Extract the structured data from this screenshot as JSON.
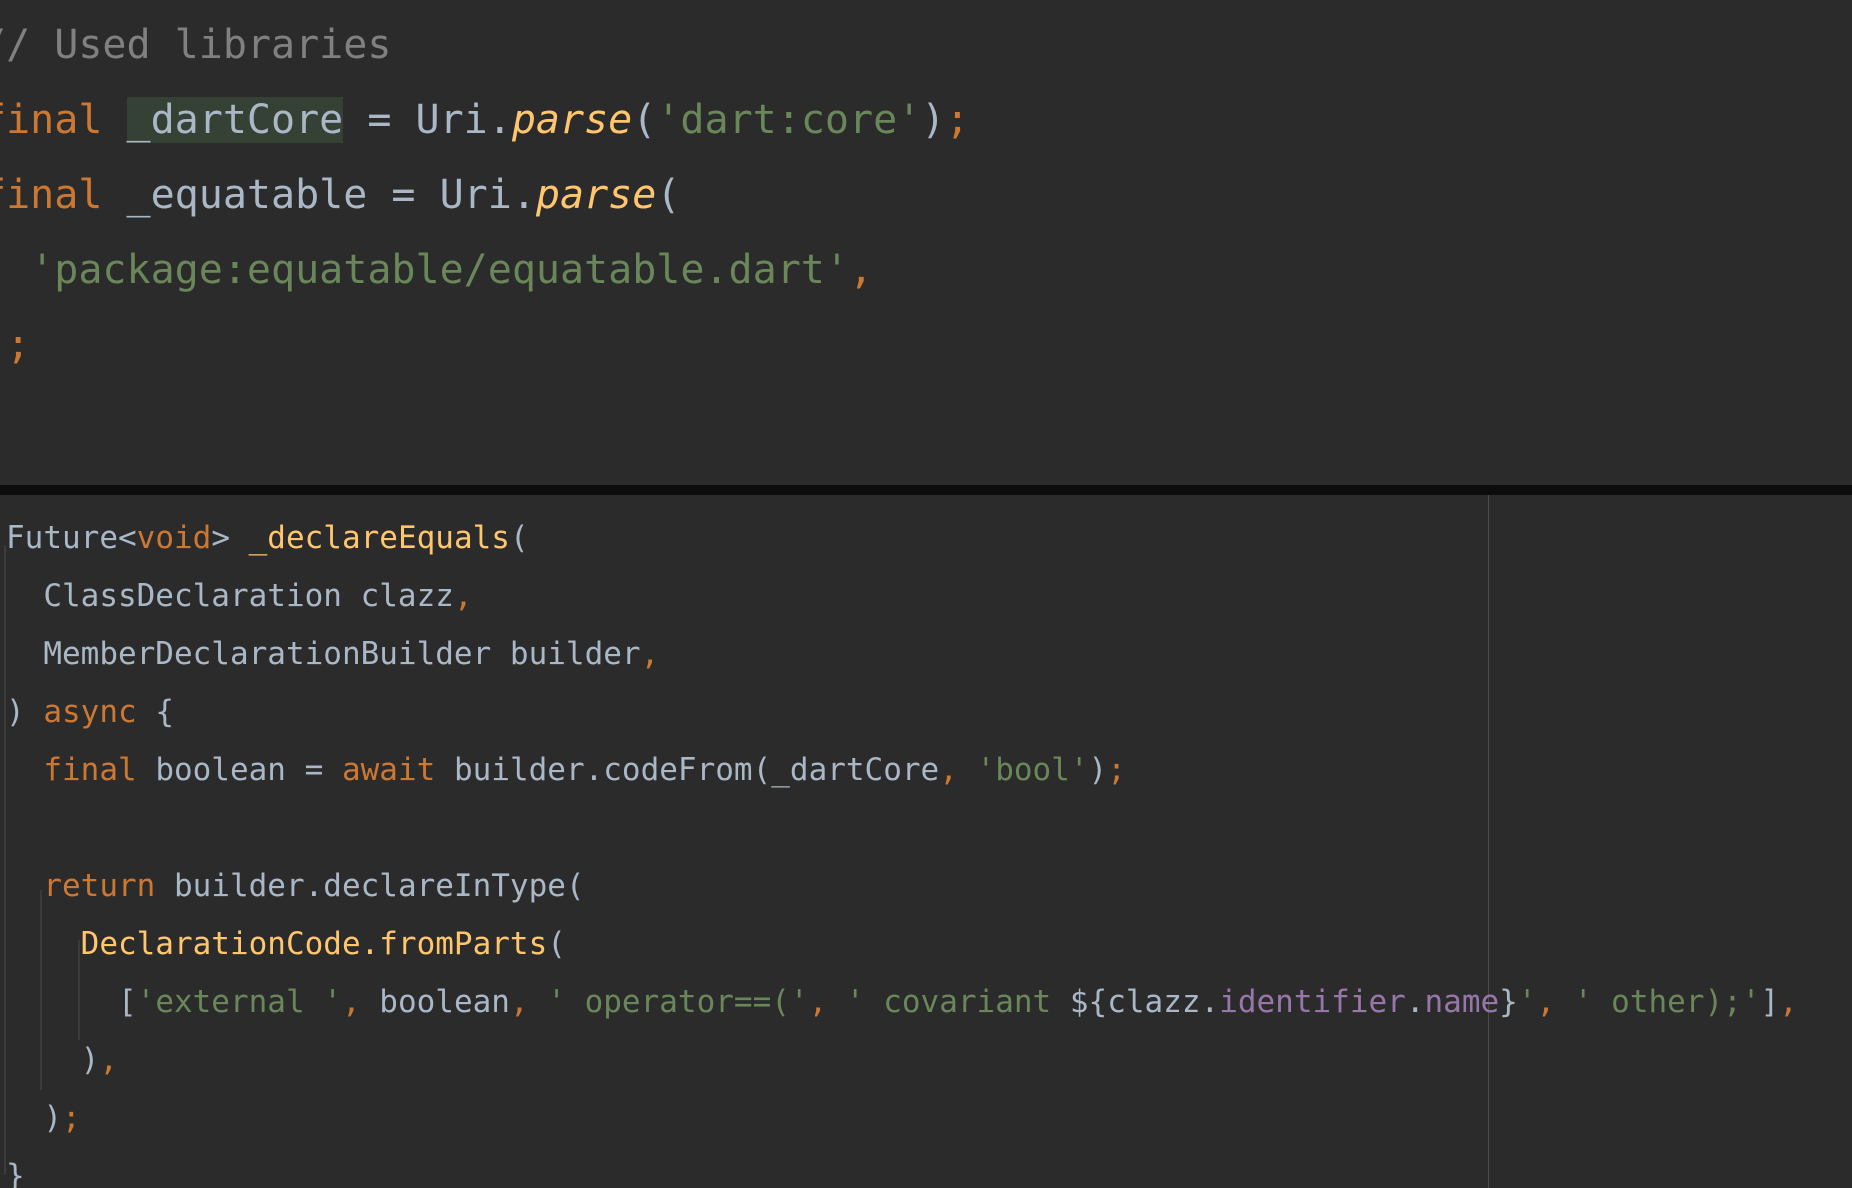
{
  "colors": {
    "background": "#2b2b2b",
    "keyword": "#cc7832",
    "identifier": "#a9b7c6",
    "string": "#6a8759",
    "function": "#ffc66d",
    "comment": "#808080",
    "property": "#9876aa",
    "highlight": "#344134"
  },
  "top_editor": {
    "lines": [
      [
        {
          "cls": "comment",
          "text": "// Used libraries"
        }
      ],
      [
        {
          "cls": "kw",
          "text": "final "
        },
        {
          "cls": "hl",
          "text": "_dartCore"
        },
        {
          "cls": "plain",
          "text": " = Uri."
        },
        {
          "cls": "fn-i",
          "text": "parse"
        },
        {
          "cls": "plain",
          "text": "("
        },
        {
          "cls": "str",
          "text": "'dart:core'"
        },
        {
          "cls": "plain",
          "text": ")"
        },
        {
          "cls": "kw",
          "text": ";"
        }
      ],
      [
        {
          "cls": "kw",
          "text": "final "
        },
        {
          "cls": "plain",
          "text": "_equatable = Uri."
        },
        {
          "cls": "fn-i",
          "text": "parse"
        },
        {
          "cls": "plain",
          "text": "("
        }
      ],
      [
        {
          "cls": "plain",
          "text": "  "
        },
        {
          "cls": "str",
          "text": "'package:equatable/equatable.dart'"
        },
        {
          "cls": "kw",
          "text": ","
        }
      ],
      [
        {
          "cls": "plain",
          "text": ")"
        },
        {
          "cls": "kw",
          "text": ";"
        }
      ]
    ]
  },
  "bottom_editor": {
    "lines": [
      [
        {
          "cls": "plain",
          "text": "Future<"
        },
        {
          "cls": "kw",
          "text": "void"
        },
        {
          "cls": "plain",
          "text": "> "
        },
        {
          "cls": "fn",
          "text": "_declareEquals"
        },
        {
          "cls": "plain",
          "text": "("
        }
      ],
      [
        {
          "cls": "plain",
          "text": "  ClassDeclaration clazz"
        },
        {
          "cls": "kw",
          "text": ","
        }
      ],
      [
        {
          "cls": "plain",
          "text": "  MemberDeclarationBuilder builder"
        },
        {
          "cls": "kw",
          "text": ","
        }
      ],
      [
        {
          "cls": "plain",
          "text": ") "
        },
        {
          "cls": "kw",
          "text": "async"
        },
        {
          "cls": "plain",
          "text": " {"
        }
      ],
      [
        {
          "cls": "plain",
          "text": "  "
        },
        {
          "cls": "kw",
          "text": "final"
        },
        {
          "cls": "plain",
          "text": " boolean = "
        },
        {
          "cls": "kw",
          "text": "await"
        },
        {
          "cls": "plain",
          "text": " builder.codeFrom(_dartCore"
        },
        {
          "cls": "kw",
          "text": ", "
        },
        {
          "cls": "str",
          "text": "'bool'"
        },
        {
          "cls": "plain",
          "text": ")"
        },
        {
          "cls": "kw",
          "text": ";"
        }
      ],
      [
        {
          "cls": "plain",
          "text": ""
        }
      ],
      [
        {
          "cls": "plain",
          "text": "  "
        },
        {
          "cls": "kw",
          "text": "return"
        },
        {
          "cls": "plain",
          "text": " builder.declareInType("
        }
      ],
      [
        {
          "cls": "plain",
          "text": "    "
        },
        {
          "cls": "fn",
          "text": "DeclarationCode.fromParts"
        },
        {
          "cls": "plain",
          "text": "("
        }
      ],
      [
        {
          "cls": "plain",
          "text": "      ["
        },
        {
          "cls": "str",
          "text": "'external '"
        },
        {
          "cls": "kw",
          "text": ", "
        },
        {
          "cls": "plain",
          "text": "boolean"
        },
        {
          "cls": "kw",
          "text": ", "
        },
        {
          "cls": "str",
          "text": "' operator==('"
        },
        {
          "cls": "kw",
          "text": ", "
        },
        {
          "cls": "str",
          "text": "' covariant "
        },
        {
          "cls": "plain",
          "text": "${clazz."
        },
        {
          "cls": "prop",
          "text": "identifier"
        },
        {
          "cls": "plain",
          "text": "."
        },
        {
          "cls": "prop",
          "text": "name"
        },
        {
          "cls": "plain",
          "text": "}"
        },
        {
          "cls": "str",
          "text": "'"
        },
        {
          "cls": "kw",
          "text": ", "
        },
        {
          "cls": "str",
          "text": "' other);'"
        },
        {
          "cls": "plain",
          "text": "]"
        },
        {
          "cls": "kw",
          "text": ","
        }
      ],
      [
        {
          "cls": "plain",
          "text": "    )"
        },
        {
          "cls": "kw",
          "text": ","
        }
      ],
      [
        {
          "cls": "plain",
          "text": "  )"
        },
        {
          "cls": "kw",
          "text": ";"
        }
      ],
      [
        {
          "cls": "plain",
          "text": "}"
        }
      ]
    ]
  }
}
